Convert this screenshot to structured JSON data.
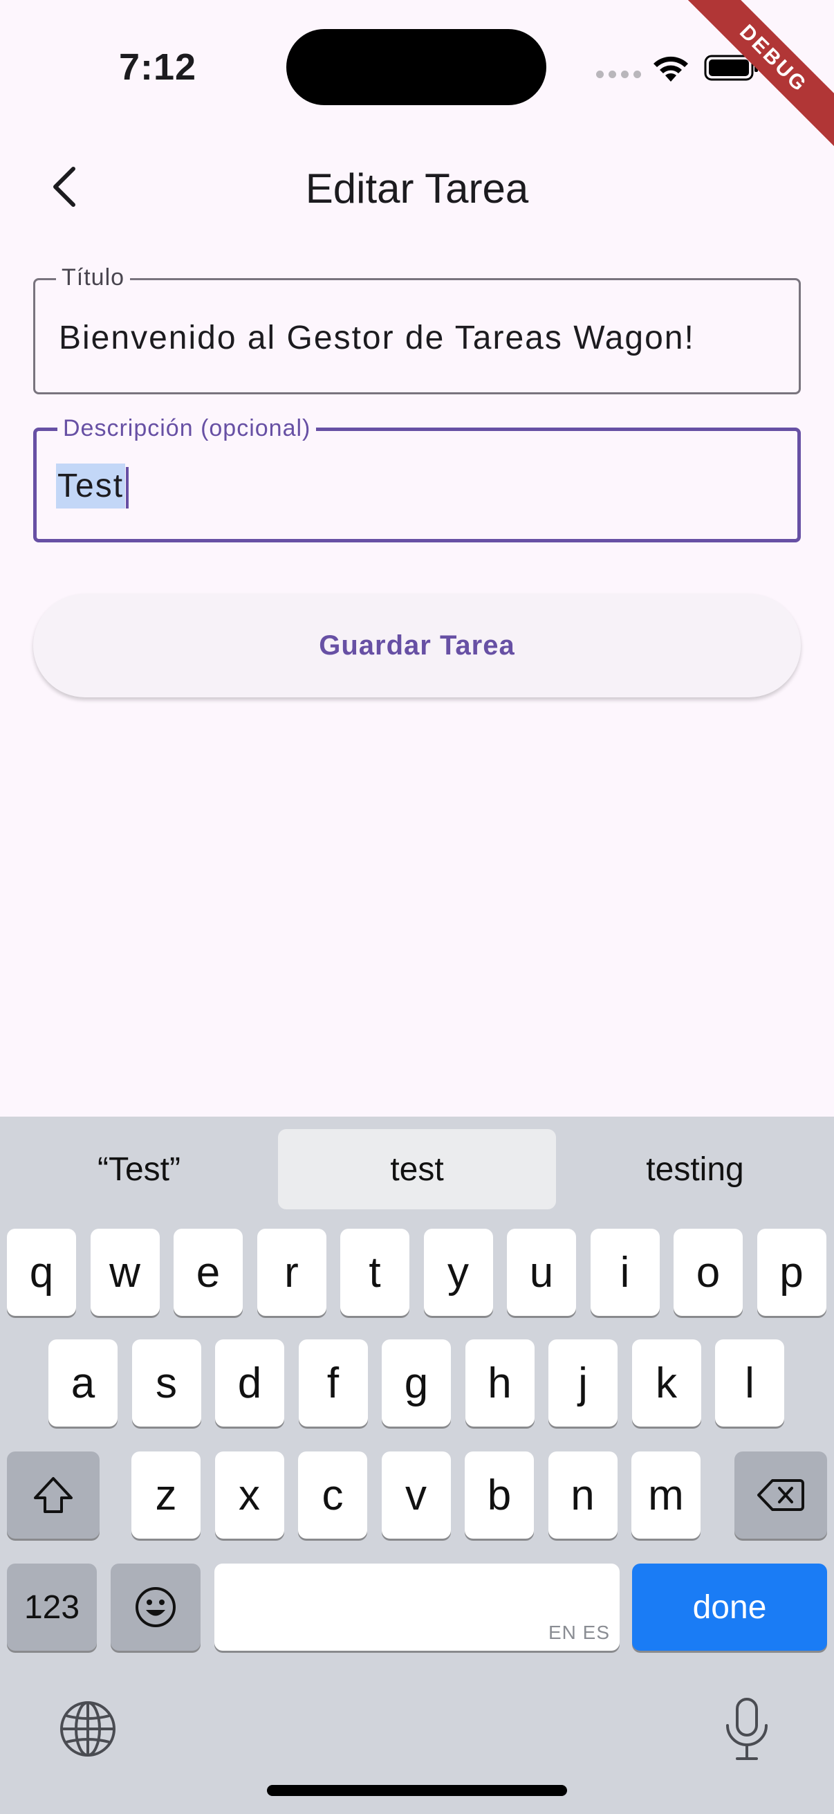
{
  "status_bar": {
    "time": "7:12"
  },
  "debug_banner": "DEBUG",
  "app_bar": {
    "title": "Editar Tarea"
  },
  "form": {
    "title_field": {
      "label": "Título",
      "value": "Bienvenido al Gestor de Tareas Wagon!"
    },
    "description_field": {
      "label": "Descripción (opcional)",
      "value": "Test"
    },
    "save_button": "Guardar Tarea"
  },
  "keyboard": {
    "suggestions": [
      "“Test”",
      "test",
      "testing"
    ],
    "row1": [
      "q",
      "w",
      "e",
      "r",
      "t",
      "y",
      "u",
      "i",
      "o",
      "p"
    ],
    "row2": [
      "a",
      "s",
      "d",
      "f",
      "g",
      "h",
      "j",
      "k",
      "l"
    ],
    "row3": [
      "z",
      "x",
      "c",
      "v",
      "b",
      "n",
      "m"
    ],
    "numbers_key": "123",
    "space_languages": "EN ES",
    "done_key": "done"
  },
  "colors": {
    "background": "#fdf6fd",
    "primary": "#6750a4",
    "done_key": "#1a7cf5",
    "keyboard_bg": "#d1d4db"
  }
}
